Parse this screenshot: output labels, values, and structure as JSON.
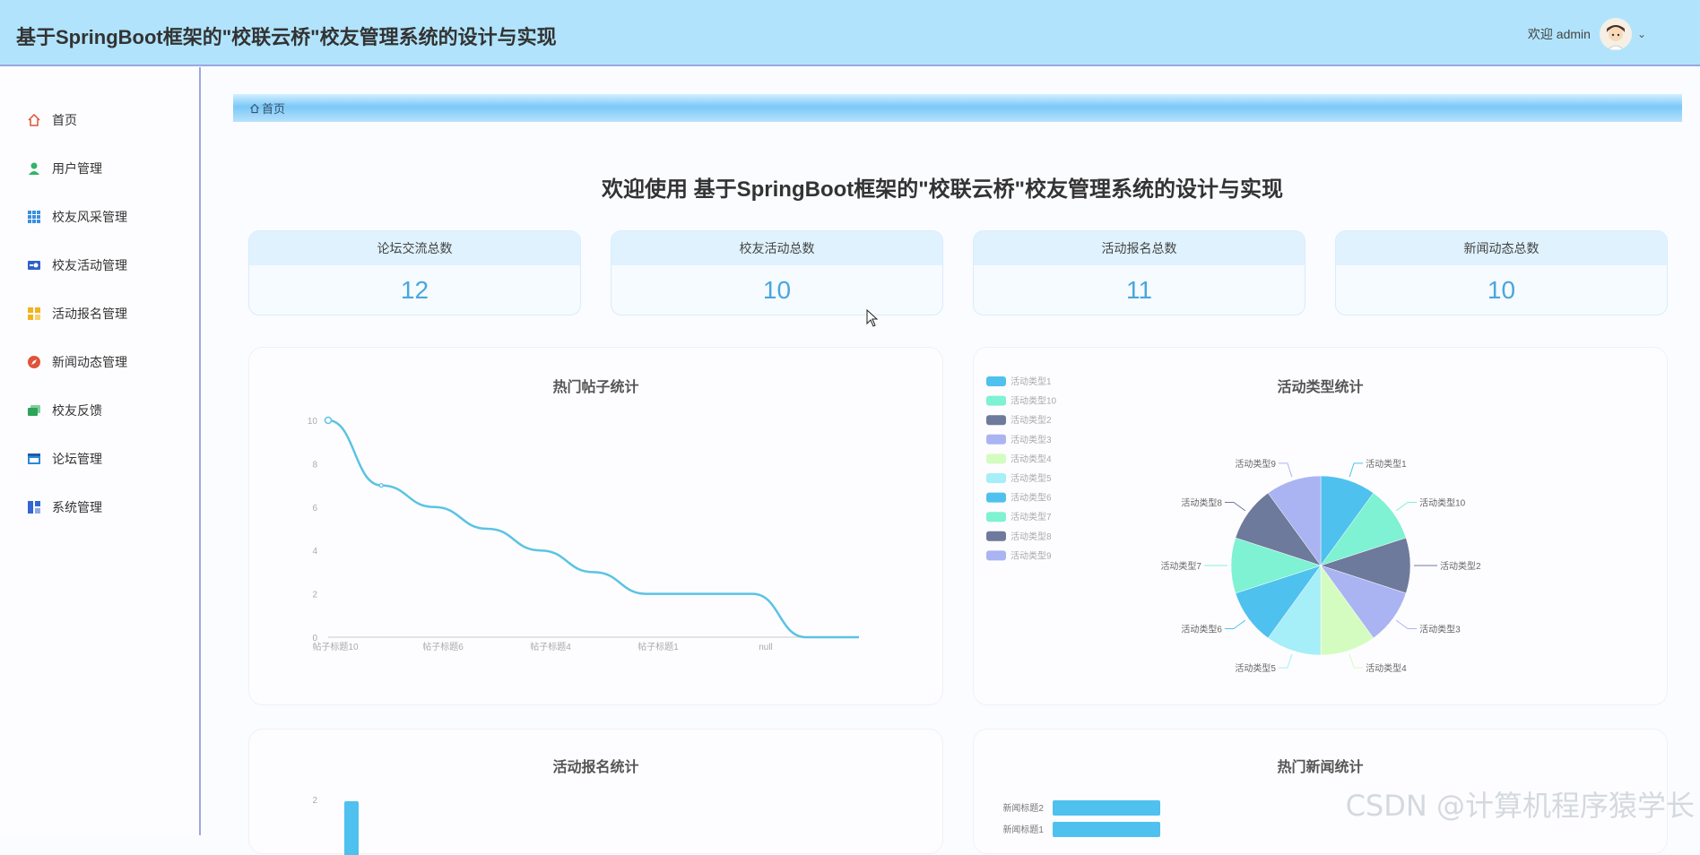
{
  "header": {
    "title": "基于SpringBoot框架的\"校联云桥\"校友管理系统的设计与实现",
    "welcome": "欢迎 admin"
  },
  "sidebar": {
    "items": [
      {
        "label": "首页",
        "icon": "home-icon"
      },
      {
        "label": "用户管理",
        "icon": "user-icon"
      },
      {
        "label": "校友风采管理",
        "icon": "grid-icon"
      },
      {
        "label": "校友活动管理",
        "icon": "toggle-icon"
      },
      {
        "label": "活动报名管理",
        "icon": "blocks-icon"
      },
      {
        "label": "新闻动态管理",
        "icon": "compass-icon"
      },
      {
        "label": "校友反馈",
        "icon": "cards-icon"
      },
      {
        "label": "论坛管理",
        "icon": "window-icon"
      },
      {
        "label": "系统管理",
        "icon": "system-icon"
      }
    ]
  },
  "breadcrumb": {
    "label": "首页"
  },
  "main": {
    "welcome": "欢迎使用 基于SpringBoot框架的\"校联云桥\"校友管理系统的设计与实现"
  },
  "stats": [
    {
      "label": "论坛交流总数",
      "value": "12"
    },
    {
      "label": "校友活动总数",
      "value": "10"
    },
    {
      "label": "活动报名总数",
      "value": "11"
    },
    {
      "label": "新闻动态总数",
      "value": "10"
    }
  ],
  "colors": {
    "header_bg": "#b1e4fc",
    "accent": "#4aa6de",
    "line": "#5bc3e3"
  },
  "watermark": "CSDN @计算机程序猿学长",
  "chart_data": [
    {
      "type": "line",
      "title": "热门帖子统计",
      "categories": [
        "帖子标题10",
        "帖子标题6",
        "帖子标题4",
        "帖子标题1",
        "null"
      ],
      "values": [
        10,
        7,
        6,
        5,
        4,
        3,
        2,
        2,
        2,
        0,
        0
      ],
      "yticks": [
        "0",
        "2",
        "4",
        "6",
        "8",
        "10"
      ],
      "ylim": [
        0,
        10
      ]
    },
    {
      "type": "pie",
      "title": "活动类型统计",
      "legend": [
        "活动类型1",
        "活动类型10",
        "活动类型2",
        "活动类型3",
        "活动类型4",
        "活动类型5",
        "活动类型6",
        "活动类型7",
        "活动类型8",
        "活动类型9"
      ],
      "values": [
        1,
        1,
        1,
        1,
        1,
        1,
        1,
        1,
        1,
        1
      ],
      "colors": [
        "#4fc1ee",
        "#7ef2d2",
        "#6e7a9c",
        "#aab4f2",
        "#d4fcc0",
        "#a6eef8",
        "#4fc1ee",
        "#7ef2d2",
        "#6e7a9c",
        "#aab4f2"
      ],
      "legend_position": "top-left"
    },
    {
      "type": "bar",
      "title": "活动报名统计",
      "yticks": [
        "2"
      ],
      "values": [
        2
      ]
    },
    {
      "type": "bar",
      "title": "热门新闻统计",
      "categories": [
        "新闻标题2",
        "新闻标题1"
      ],
      "values": [
        1,
        1
      ]
    }
  ]
}
